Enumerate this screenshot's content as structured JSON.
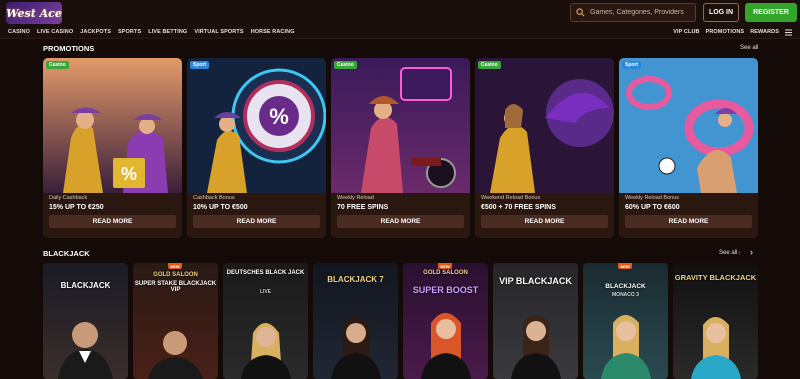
{
  "header": {
    "logo_text": "West Ace",
    "search_placeholder": "Games, Categories, Providers",
    "login_label": "LOG IN",
    "register_label": "REGISTER",
    "register_color": "#33a52a"
  },
  "nav": {
    "left": [
      "CASINO",
      "LIVE CASINO",
      "JACKPOTS",
      "SPORTS",
      "LIVE BETTING",
      "VIRTUAL SPORTS",
      "HORSE RACING"
    ],
    "right": [
      "VIP CLUB",
      "PROMOTIONS",
      "REWARDS"
    ],
    "menu_icon": "hamburger-icon"
  },
  "promotions": {
    "title": "PROMOTIONS",
    "see_all": "See all",
    "cards": [
      {
        "badge": "Casino",
        "type": "Daily Cashback",
        "offer": "15% UP TO €250",
        "button": "READ MORE"
      },
      {
        "badge": "Sport",
        "type": "Cashback Bonus",
        "offer": "10% UP TO €500",
        "button": "READ MORE"
      },
      {
        "badge": "Casino",
        "type": "Weekly Reload",
        "offer": "70 FREE SPINS",
        "button": "READ MORE"
      },
      {
        "badge": "Casino",
        "type": "Weekend Reload Bonus",
        "offer": "€500 + 70 FREE SPINS",
        "button": "READ MORE"
      },
      {
        "badge": "Sport",
        "type": "Weekly Reload Bonus",
        "offer": "60% UP TO €600",
        "button": "READ MORE"
      }
    ]
  },
  "blackjack": {
    "title": "BLACKJACK",
    "see_all": "See all",
    "games": [
      {
        "title": "BLACKJACK",
        "subtitle": "",
        "new": ""
      },
      {
        "title": "GOLD SALOON",
        "subtitle": "SUPER STAKE BLACKJACK VIP",
        "new": "NEW"
      },
      {
        "title": "DEUTSCHES BLACK JACK",
        "subtitle": "LIVE",
        "new": ""
      },
      {
        "title": "BLACKJACK 7",
        "subtitle": "",
        "new": ""
      },
      {
        "title": "GOLD SALOON",
        "subtitle": "SUPER BOOST",
        "new": "NEW"
      },
      {
        "title": "VIP BLACKJACK",
        "subtitle": "",
        "new": ""
      },
      {
        "title": "BLACKJACK",
        "subtitle": "MONACO 3",
        "new": "NEW"
      },
      {
        "title": "GRAVITY BLACKJACK",
        "subtitle": "",
        "new": ""
      }
    ]
  }
}
